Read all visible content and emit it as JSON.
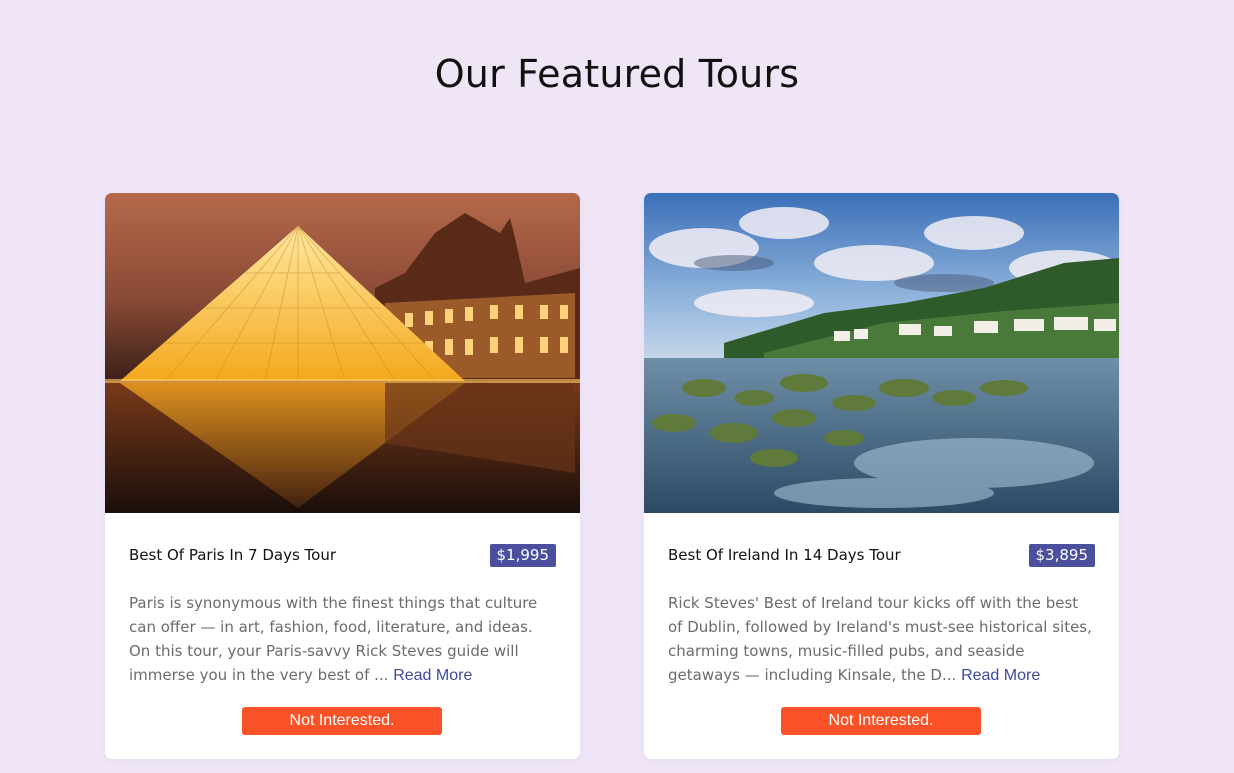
{
  "page": {
    "title": "Our Featured Tours"
  },
  "colors": {
    "background": "#efe5f7",
    "price_badge": "#4a4f9e",
    "button": "#fb5126",
    "link": "#3d4a9e"
  },
  "tours": [
    {
      "name": "Best Of Paris In 7 Days Tour",
      "price": "$1,995",
      "description": "Paris is synonymous with the finest things that culture can offer — in art, fashion, food, literature, and ideas. On this tour, your Paris-savvy Rick Steves guide will immerse you in the very best of ...",
      "read_more": "Read More",
      "button_label": "Not Interested.",
      "image_alt": "louvre-pyramid-image"
    },
    {
      "name": "Best Of Ireland In 14 Days Tour",
      "price": "$3,895",
      "description": "Rick Steves' Best of Ireland tour kicks off with the best of Dublin, followed by Ireland's must-see historical sites, charming towns, music-filled pubs, and seaside getaways — including Kinsale, the D...",
      "read_more": "Read More",
      "button_label": "Not Interested.",
      "image_alt": "irish-coast-image"
    }
  ]
}
